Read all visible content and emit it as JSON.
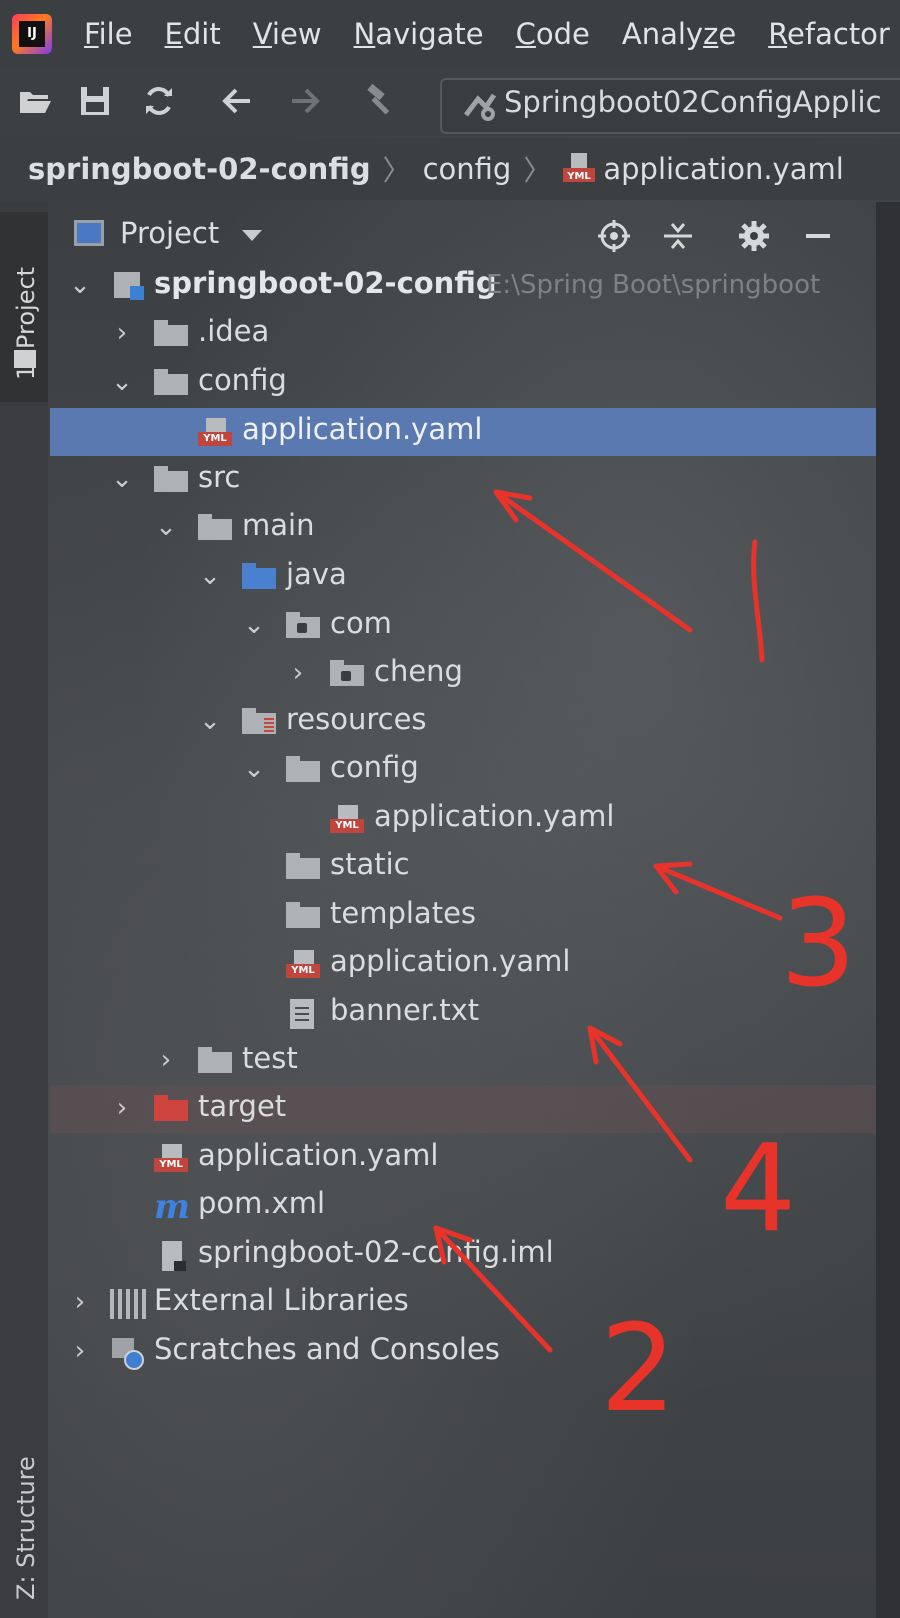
{
  "menu": {
    "items": [
      {
        "pre": "",
        "u": "F",
        "post": "ile"
      },
      {
        "pre": "",
        "u": "E",
        "post": "dit"
      },
      {
        "pre": "",
        "u": "V",
        "post": "iew"
      },
      {
        "pre": "",
        "u": "N",
        "post": "avigate"
      },
      {
        "pre": "",
        "u": "C",
        "post": "ode"
      },
      {
        "pre": "Analy",
        "u": "z",
        "post": "e"
      },
      {
        "pre": "",
        "u": "R",
        "post": "efactor"
      }
    ],
    "logo_text": "IJ"
  },
  "toolbar": {
    "run_config_label": "Springboot02ConfigApplic"
  },
  "breadcrumb": {
    "project": "springboot-02-config",
    "folder": "config",
    "file": "application.yaml"
  },
  "left_strip": {
    "project_tab": "1: Project",
    "structure_tab": "Z: Structure"
  },
  "project_panel": {
    "title": "Project",
    "tree": {
      "root": {
        "label": "springboot-02-config",
        "path": "E:\\Spring Boot\\springboot"
      },
      "idea": ".idea",
      "config": "config",
      "config_app_yaml": "application.yaml",
      "src": "src",
      "main": "main",
      "java": "java",
      "com": "com",
      "cheng": "cheng",
      "resources": "resources",
      "res_config": "config",
      "res_config_app_yaml": "application.yaml",
      "static": "static",
      "templates": "templates",
      "res_app_yaml": "application.yaml",
      "banner": "banner.txt",
      "test": "test",
      "target": "target",
      "root_app_yaml": "application.yaml",
      "pom": "pom.xml",
      "iml": "springboot-02-config.iml",
      "external_libraries": "External Libraries",
      "scratches": "Scratches and Consoles"
    }
  },
  "annotations": {
    "n1": "1",
    "n2": "2",
    "n3": "3",
    "n4": "4",
    "color": "#e8332b"
  },
  "icons": {
    "yml_tag": "YML",
    "maven": "m"
  },
  "colors": {
    "selection": "#5a79b0",
    "source_folder": "#4a80d0",
    "excluded_folder": "#d0443f"
  }
}
